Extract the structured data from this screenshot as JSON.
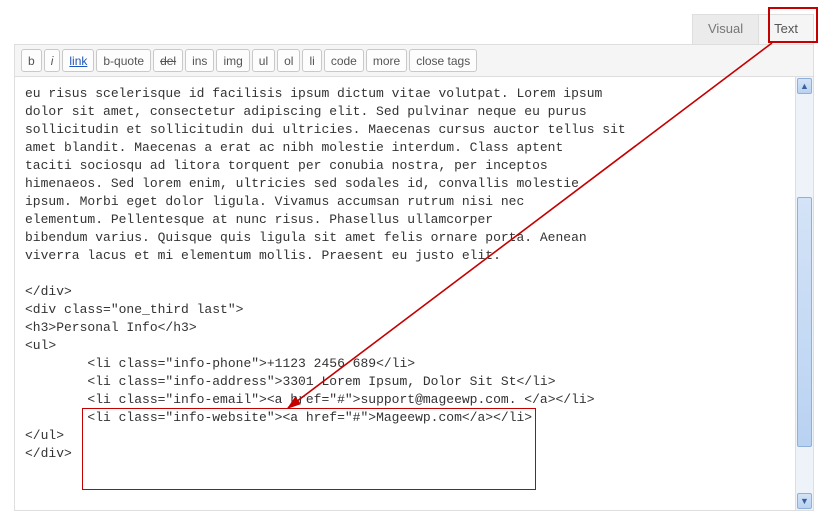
{
  "tabs": {
    "visual": "Visual",
    "text": "Text"
  },
  "toolbar": {
    "b": "b",
    "i": "i",
    "link": "link",
    "bquote": "b-quote",
    "del": "del",
    "ins": "ins",
    "img": "img",
    "ul": "ul",
    "ol": "ol",
    "li": "li",
    "code": "code",
    "more": "more",
    "close": "close tags"
  },
  "content": "eu risus scelerisque id facilisis ipsum dictum vitae volutpat. Lorem ipsum\ndolor sit amet, consectetur adipiscing elit. Sed pulvinar neque eu purus\nsollicitudin et sollicitudin dui ultricies. Maecenas cursus auctor tellus sit\namet blandit. Maecenas a erat ac nibh molestie interdum. Class aptent\ntaciti sociosqu ad litora torquent per conubia nostra, per inceptos\nhimenaeos. Sed lorem enim, ultricies sed sodales id, convallis molestie\nipsum. Morbi eget dolor ligula. Vivamus accumsan rutrum nisi nec\nelementum. Pellentesque at nunc risus. Phasellus ullamcorper\nbibendum varius. Quisque quis ligula sit amet felis ornare porta. Aenean\nviverra lacus et mi elementum mollis. Praesent eu justo elit.\n\n</div>\n<div class=\"one_third last\">\n<h3>Personal Info</h3>\n<ul>\n        <li class=\"info-phone\">+1123 2456 689</li>\n        <li class=\"info-address\">3301 Lorem Ipsum, Dolor Sit St</li>\n        <li class=\"info-email\"><a href=\"#\">support@mageewp.com. </a></li>\n        <li class=\"info-website\"><a href=\"#\">Mageewp.com</a></li>\n</ul>\n</div>"
}
